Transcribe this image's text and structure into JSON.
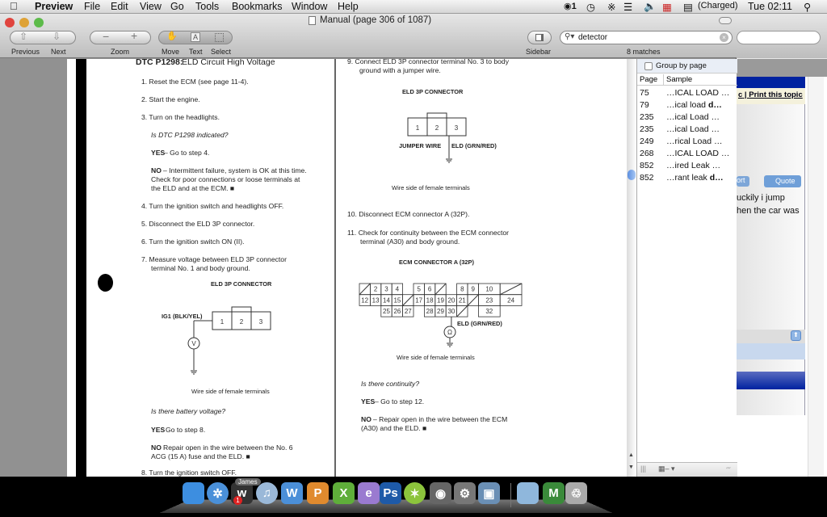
{
  "menubar": {
    "app": "Preview",
    "items": [
      "File",
      "Edit",
      "View",
      "Go",
      "Tools",
      "Bookmarks",
      "Window",
      "Help"
    ],
    "status": {
      "adium_count": "1",
      "battery": "(Charged)",
      "clock": "Tue 02:11"
    }
  },
  "window": {
    "title": "Manual (page 306 of 1087)",
    "toolbar": {
      "previous": "Previous",
      "next": "Next",
      "zoom": "Zoom",
      "move": "Move",
      "text": "Text",
      "select": "Select",
      "sidebar": "Sidebar",
      "search_value": "detector",
      "matches": "8 matches"
    }
  },
  "page": {
    "left": {
      "title_code": "DTC P1298:",
      "title_rest": " ELD Circuit High Voltage",
      "steps": [
        "1.  Reset the ECM  (see page 11-4).",
        "2.  Start the engine.",
        "3.  Turn on the headlights."
      ],
      "q1": "Is DTC P1298 indicated?",
      "yes1_b": "YES",
      "yes1": " – Go to step 4.",
      "no1_b": "NO",
      "no1": [
        "– Intermittent failure, system is OK at this time.",
        "Check for poor connections or loose terminals at",
        "the ELD and at the ECM. ■"
      ],
      "steps2": [
        "4.  Turn the ignition switch and headlights OFF.",
        "5.  Disconnect the ELD 3P connector.",
        "6.  Turn the ignition switch ON (II)."
      ],
      "step7": [
        "7.  Measure voltage between ELD 3P connector",
        "terminal No. 1 and body ground."
      ],
      "conn_title": "ELD 3P CONNECTOR",
      "wire_label": "IG1 (BLK/YEL)",
      "pins": [
        "1",
        "2",
        "3"
      ],
      "caption": "Wire side of female terminals",
      "q2": "Is there battery voltage?",
      "yes2_b": "YES",
      "yes2": "   Go to step 8.",
      "no2_b": "NO",
      "no2": [
        "   Repair open in the wire between the No. 6",
        "ACG (15 A) fuse and the ELD. ■"
      ],
      "step8": "8.  Turn the ignition switch OFF."
    },
    "right": {
      "step9": [
        "9.  Connect ELD 3P connector terminal No. 3 to body",
        "ground with a jumper wire."
      ],
      "conn_title": "ELD 3P CONNECTOR",
      "pins": [
        "1",
        "2",
        "3"
      ],
      "jumper": "JUMPER WIRE",
      "eld": "ELD (GRN/RED)",
      "caption": "Wire side of female terminals",
      "step10": "10.  Disconnect ECM connector A (32P).",
      "step11": [
        "11.  Check for continuity between the ECM connector",
        "terminal (A30) and body ground."
      ],
      "ecm_title": "ECM CONNECTOR A (32P)",
      "ecm_rows": [
        [
          "/",
          "2",
          "3",
          "4",
          null,
          "5",
          "6",
          "/",
          null,
          "8",
          "9",
          "10",
          "/"
        ],
        [
          "12",
          "13",
          "14",
          "15",
          "/",
          "17",
          "18",
          "19",
          "20",
          "21",
          "/",
          "23",
          "24"
        ],
        [
          null,
          null,
          "25",
          "26",
          "27",
          null,
          "28",
          "29",
          "30",
          "/",
          null,
          "32",
          null
        ]
      ],
      "ecm_eld": "ELD (GRN/RED)",
      "caption2": "Wire side of female terminals",
      "q": "Is there continuity?",
      "yes_b": "YES",
      "yes": " – Go to step 12.",
      "no_b": "NO",
      "no": [
        "– Repair open in the wire between the ECM",
        "(A30) and the ELD. ■"
      ]
    }
  },
  "sidebar": {
    "group_by_page": "Group by page",
    "group_checked": false,
    "col_page": "Page",
    "col_sample": "Sample",
    "results": [
      {
        "page": "75",
        "sample": "…ICAL  LOAD …"
      },
      {
        "page": "79",
        "sample": "…ical  load  ",
        "bold": "d…"
      },
      {
        "page": "235",
        "sample": "…ical  Load  …"
      },
      {
        "page": "235",
        "sample": "…ical  Load  …"
      },
      {
        "page": "249",
        "sample": "…rical  Load …"
      },
      {
        "page": "268",
        "sample": "…ICAL  LOAD …"
      },
      {
        "page": "852",
        "sample": "…ired  Leak  …"
      },
      {
        "page": "852",
        "sample": "…rant  leak  ",
        "bold": "d…"
      }
    ]
  },
  "background_browser": {
    "link_fragment": "c",
    "print_topic": "Print this topic",
    "report_fragment": "ort",
    "quote": "Quote",
    "post_lines": [
      "uckily i jump",
      "hen the car was"
    ]
  },
  "dock": {
    "badge_label": "James",
    "badge_count": "1",
    "apps": [
      {
        "name": "finder",
        "glyph": "",
        "color": "#3d8ee0"
      },
      {
        "name": "safari",
        "glyph": "✲",
        "color": "#4a90d9"
      },
      {
        "name": "adium",
        "glyph": "w",
        "color": "#333"
      },
      {
        "name": "itunes",
        "glyph": "♫",
        "color": "#9ab8d8"
      },
      {
        "name": "word",
        "glyph": "W",
        "color": "#4b8fd8"
      },
      {
        "name": "powerpoint",
        "glyph": "P",
        "color": "#e08a2e"
      },
      {
        "name": "excel",
        "glyph": "X",
        "color": "#5fae3a"
      },
      {
        "name": "entourage",
        "glyph": "e",
        "color": "#9a7ad0"
      },
      {
        "name": "photoshop",
        "glyph": "Ps",
        "color": "#1e5aa8"
      },
      {
        "name": "limewire",
        "glyph": "✶",
        "color": "#8cc43c"
      },
      {
        "name": "imovie",
        "glyph": "◉",
        "color": "#666"
      },
      {
        "name": "system-preferences",
        "glyph": "⚙",
        "color": "#777"
      },
      {
        "name": "iphoto",
        "glyph": "▣",
        "color": "#6a8fb5"
      },
      {
        "name": "documents-folder",
        "glyph": "",
        "color": "#8fb7dc"
      },
      {
        "name": "pictures-stack",
        "glyph": "M",
        "color": "#3a8a3a"
      },
      {
        "name": "trash",
        "glyph": "♲",
        "color": "#aaa"
      }
    ]
  },
  "colors": {
    "selection": "#3875d7",
    "forum_blue": "#0022a0"
  }
}
